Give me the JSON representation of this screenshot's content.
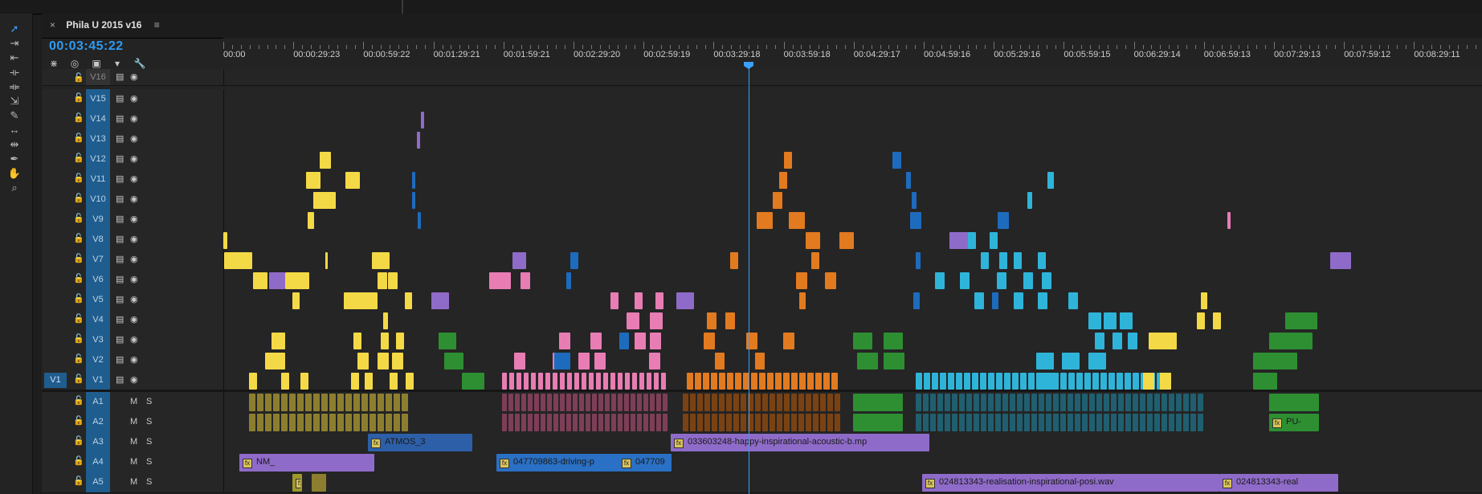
{
  "sequence": {
    "tab_title": "Phila U 2015 v16",
    "timecode": "00:03:45:22"
  },
  "ruler": {
    "ticks": [
      "00:00",
      "00:00:29:23",
      "00:00:59:22",
      "00:01:29:21",
      "00:01:59:21",
      "00:02:29:20",
      "00:02:59:19",
      "00:03:29:18",
      "00:03:59:18",
      "00:04:29:17",
      "00:04:59:16",
      "00:05:29:16",
      "00:05:59:15",
      "00:06:29:14",
      "00:06:59:13",
      "00:07:29:13",
      "00:07:59:12",
      "00:08:29:11"
    ]
  },
  "video_tracks": [
    "V16",
    "V15",
    "V14",
    "V13",
    "V12",
    "V11",
    "V10",
    "V9",
    "V8",
    "V7",
    "V6",
    "V5",
    "V4",
    "V3",
    "V2",
    "V1"
  ],
  "audio_tracks": [
    "A1",
    "A2",
    "A3",
    "A4",
    "A5"
  ],
  "source_patch": {
    "video": "V1"
  },
  "audio_buttons": {
    "mute": "M",
    "solo": "S"
  },
  "clip_labels": {
    "atmos": "ATMOS_3",
    "happy": "033603248-happy-inspirational-acoustic-b.mp",
    "nm": "NM_",
    "driving": "047709863-driving-p",
    "driving2": "047709",
    "realisation": "024813343-realisation-inspirational-posi.wav",
    "real2": "024813343-real",
    "pu": "PU-",
    "c": "C"
  },
  "colors": {
    "yellow": "#f4d946",
    "purple": "#8f6bc9",
    "pink": "#e87db4",
    "orange": "#e27a20",
    "blue": "#1d6bbd",
    "cyan": "#2fb4d9",
    "green": "#2d8f32",
    "playhead": "#3aa0ff"
  }
}
